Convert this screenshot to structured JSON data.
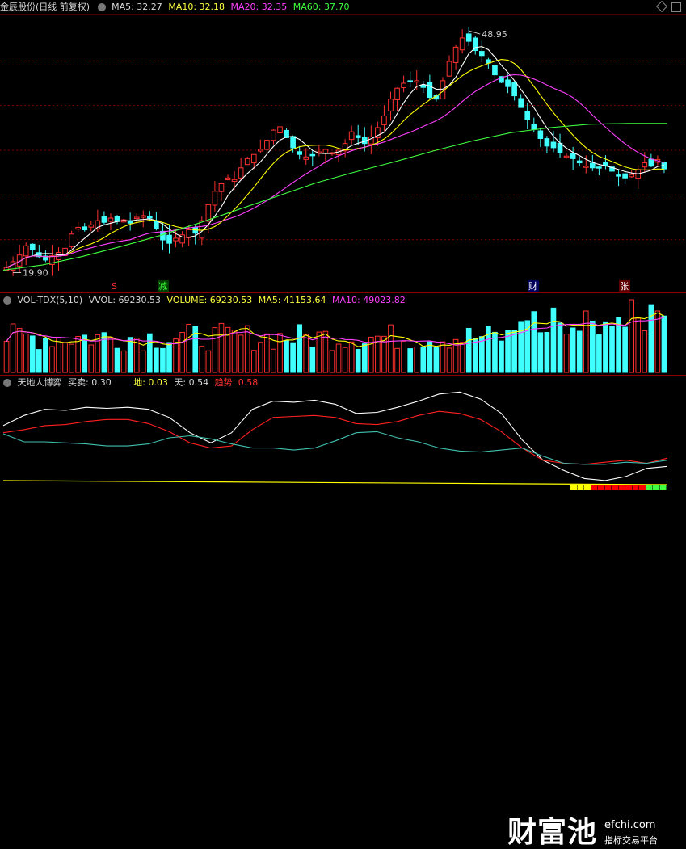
{
  "main_header": {
    "stock": "金辰股份(日线 前复权)",
    "ma5": "MA5: 32.27",
    "ma10": "MA10: 32.18",
    "ma20": "MA20: 32.35",
    "ma60": "MA60: 37.70"
  },
  "vol_header": {
    "name": "VOL-TDX(5,10)",
    "vvol": "VVOL: 69230.53",
    "volume": "VOLUME: 69230.53",
    "ma5": "MA5: 41153.64",
    "ma10": "MA10: 49023.82"
  },
  "osc_header": {
    "name": "天地人博弈",
    "buy_sell": "买卖: 0.30",
    "di": "地: 0.03",
    "tian": "天: 0.54",
    "trend": "趋势: 0.58"
  },
  "markers": {
    "s": "S",
    "jian": "减",
    "cai": "财",
    "zhang": "张"
  },
  "price_labels": {
    "high": "48.95",
    "low": "19.90"
  },
  "watermark": {
    "big": "财富池",
    "site": "efchi.com",
    "sub": "指标交易平台"
  },
  "colors": {
    "up": "#ff3030",
    "down": "#40ffff",
    "ma5": "#ffffff",
    "ma10": "#ffff00",
    "ma20": "#ff40ff",
    "ma60": "#40ff40"
  },
  "chart_data": {
    "type": "candlestick",
    "price_extremes": {
      "high": 48.95,
      "low": 19.9
    },
    "close_trend": [
      20.5,
      21.2,
      22.0,
      23.1,
      22.6,
      21.8,
      21.4,
      21.9,
      22.3,
      22.8,
      24.5,
      25.3,
      25.0,
      25.6,
      26.1,
      25.9,
      26.4,
      26.0,
      26.2,
      25.8,
      26.5,
      26.7,
      26.4,
      25.1,
      23.8,
      23.4,
      24.0,
      24.4,
      25.0,
      24.6,
      26.1,
      28.0,
      29.6,
      30.5,
      31.2,
      31.0,
      32.4,
      33.5,
      34.0,
      34.6,
      35.7,
      36.9,
      37.3,
      36.0,
      34.8,
      34.0,
      33.7,
      33.9,
      34.3,
      34.6,
      34.2,
      34.5,
      35.3,
      36.7,
      36.0,
      35.3,
      36.1,
      37.2,
      38.6,
      40.6,
      41.9,
      42.5,
      42.7,
      42.8,
      42.0,
      40.8,
      40.6,
      42.8,
      45.1,
      46.8,
      47.9,
      47.5,
      46.4,
      45.8,
      44.9,
      43.5,
      42.6,
      42.1,
      41.0,
      39.6,
      38.2,
      37.0,
      35.9,
      35.0,
      34.8,
      34.2,
      33.8,
      33.5,
      33.0,
      32.6,
      32.4,
      32.5,
      32.7,
      32.0,
      31.4,
      31.2,
      31.6,
      32.2,
      33.0,
      32.6,
      33.4,
      32.27
    ],
    "ma60_trend": [
      20.2,
      20.8,
      21.8,
      23.0,
      24.3,
      25.8,
      27.4,
      29.0,
      30.6,
      31.9,
      33.1,
      34.4,
      35.6,
      36.6,
      37.2,
      37.6,
      37.7,
      37.7
    ],
    "current": {
      "ma5": 32.27,
      "ma10": 32.18,
      "ma20": 32.35,
      "ma60": 37.7
    },
    "volume": {
      "vvol": 69230.53,
      "volume": 69230.53,
      "ma5": 41153.64,
      "ma10": 49023.82
    },
    "oscillator": {
      "buy_sell": 0.3,
      "di": 0.03,
      "tian": 0.54,
      "trend": 0.58
    }
  }
}
